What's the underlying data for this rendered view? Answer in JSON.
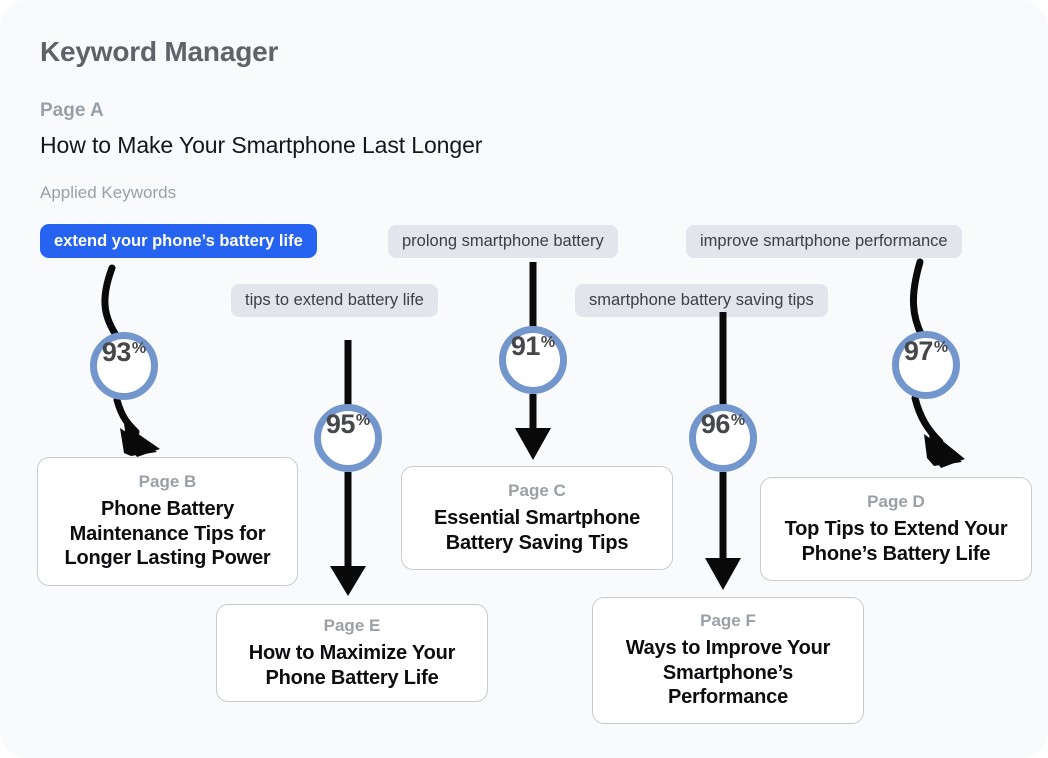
{
  "app": {
    "title": "Keyword Manager",
    "background_color": "#f8fafc"
  },
  "source_page": {
    "label": "Page A",
    "title": "How to Make Your Smartphone Last Longer"
  },
  "keywords_section": {
    "heading": "Applied Keywords",
    "active_color": "#2563f0",
    "chip_color": "#e2e6ec",
    "chips": [
      {
        "text": "extend your phone’s battery life",
        "active": true
      },
      {
        "text": "prolong smartphone battery",
        "active": false
      },
      {
        "text": "improve smartphone performance",
        "active": false
      },
      {
        "text": "tips to extend battery life",
        "active": false
      },
      {
        "text": "smartphone battery saving tips",
        "active": false
      }
    ]
  },
  "scores": {
    "ring_color": "#7396cc",
    "percent_symbol": "%",
    "items": [
      {
        "value": "93",
        "for_page": "Page B"
      },
      {
        "value": "95",
        "for_page": "Page E"
      },
      {
        "value": "91",
        "for_page": "Page C"
      },
      {
        "value": "96",
        "for_page": "Page F"
      },
      {
        "value": "97",
        "for_page": "Page D"
      }
    ]
  },
  "pages": [
    {
      "label": "Page B",
      "title": "Phone Battery Maintenance Tips for Longer Lasting Power"
    },
    {
      "label": "Page C",
      "title": "Essential Smartphone Battery Saving Tips"
    },
    {
      "label": "Page D",
      "title": "Top Tips to Extend Your Phone’s Battery Life"
    },
    {
      "label": "Page E",
      "title": "How to Maximize Your Phone Battery Life"
    },
    {
      "label": "Page F",
      "title": "Ways to Improve Your Smartphone’s Performance"
    }
  ]
}
